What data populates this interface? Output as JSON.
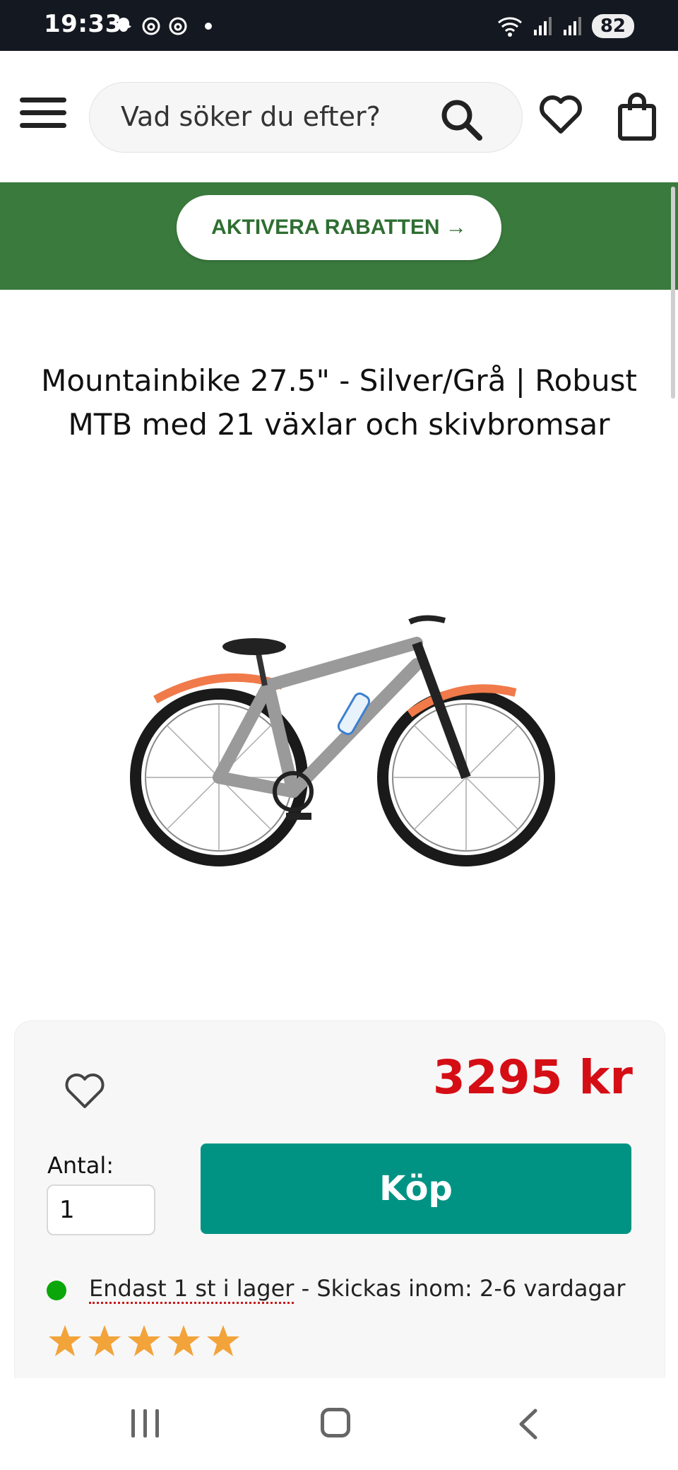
{
  "status_bar": {
    "time": "19:33",
    "battery": "82",
    "icons": [
      "snapchat-icon",
      "threads-icon",
      "threads-icon",
      "dot-icon",
      "wifi-icon",
      "signal-icon",
      "signal-icon"
    ]
  },
  "header": {
    "search_placeholder": "Vad söker du efter?",
    "icons": [
      "menu-icon",
      "search-icon",
      "heart-icon",
      "shopping-bag-icon"
    ]
  },
  "banner": {
    "button_label": "AKTIVERA RABATTEN →",
    "color": "#3a7a3d"
  },
  "product": {
    "title": "Mountainbike 27.5\" - Silver/Grå | Robust MTB med 21 växlar och skivbromsar",
    "image_alt": "Mountainbike 27.5 silver/grå",
    "price": "3295 kr",
    "price_color": "#d50d15",
    "quantity_label": "Antal:",
    "quantity_value": "1",
    "buy_label": "Köp",
    "buy_color": "#009383",
    "stock_link": "Endast 1 st i lager",
    "stock_rest": " - Skickas inom: 2-6 vardagar",
    "rating_stars": 5
  }
}
